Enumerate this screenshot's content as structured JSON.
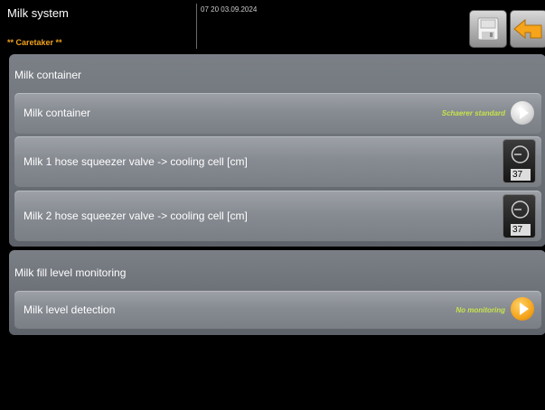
{
  "header": {
    "title": "Milk system",
    "role": "** Caretaker **",
    "datetime": "07 20 03.09.2024",
    "save_icon": "save-disk-icon",
    "back_icon": "back-arrow-icon"
  },
  "colors": {
    "accent_orange": "#f5a41b",
    "value_green": "#c7e34a",
    "panel": "#6b6f76",
    "row": "#8a8e95"
  },
  "sections": [
    {
      "title": "Milk container",
      "rows": [
        {
          "label": "Milk container",
          "value": "Schaerer standard",
          "control": "play-grey"
        },
        {
          "label": "Milk 1 hose squeezer valve -> cooling cell [cm]",
          "gauge_value": "37",
          "control": "gauge"
        },
        {
          "label": "Milk 2 hose squeezer valve -> cooling cell [cm]",
          "gauge_value": "37",
          "control": "gauge"
        }
      ]
    },
    {
      "title": "Milk fill level monitoring",
      "rows": [
        {
          "label": "Milk level detection",
          "value": "No monitoring",
          "control": "play-orange"
        }
      ]
    }
  ]
}
